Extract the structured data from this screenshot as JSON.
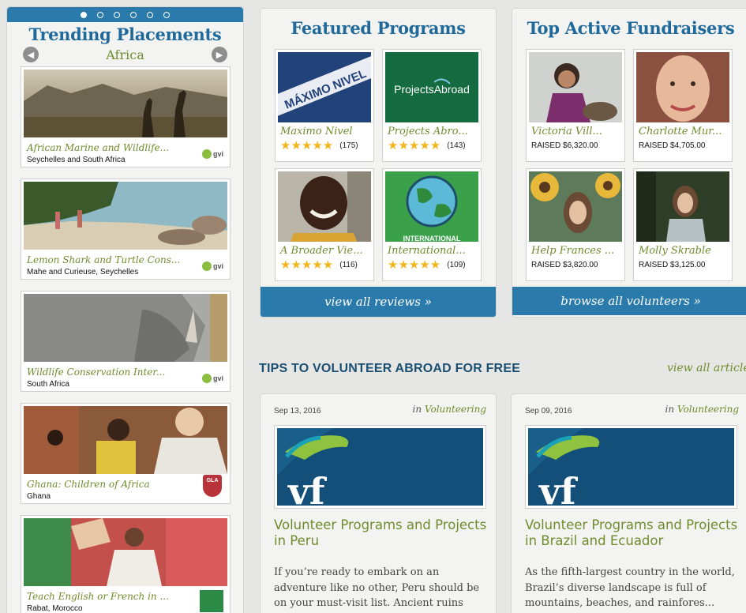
{
  "trending": {
    "title": "Trending Placements",
    "region": "Africa",
    "prev_icon": "chevron-left-icon",
    "next_icon": "chevron-right-icon",
    "placements": [
      {
        "title": "African Marine and Wildlife...",
        "location": "Seychelles and South Africa",
        "logo": "gvi"
      },
      {
        "title": "Lemon Shark and Turtle Cons...",
        "location": "Mahe and Curieuse, Seychelles",
        "logo": "gvi"
      },
      {
        "title": "Wildlife Conservation Inter...",
        "location": "South Africa",
        "logo": "gvi"
      },
      {
        "title": "Ghana: Children of Africa",
        "location": "Ghana",
        "logo": "GLA"
      },
      {
        "title": "Teach English or French in ...",
        "location": "Rabat, Morocco",
        "logo": ""
      }
    ]
  },
  "featured": {
    "title": "Featured Programs",
    "footer": "view all reviews »",
    "items": [
      {
        "name": "Maximo Nivel",
        "count": "(175)",
        "image_text": "MÁXIMO NIVEL"
      },
      {
        "name": "Projects Abro...",
        "count": "(143)",
        "image_text": "ProjectsAbroad"
      },
      {
        "name": "A Broader Vie...",
        "count": "(116)"
      },
      {
        "name": "International...",
        "count": "(109)",
        "image_text": "INTERNATIONAL"
      }
    ]
  },
  "fundraisers": {
    "title": "Top Active Fundraisers",
    "footer": "browse all volunteers »",
    "items": [
      {
        "name": "Victoria Vill...",
        "raised": "RAISED $6,320.00"
      },
      {
        "name": "Charlotte Mur...",
        "raised": "RAISED $4,705.00"
      },
      {
        "name": "Help Frances ...",
        "raised": "RAISED $3,820.00"
      },
      {
        "name": "Molly Skrable",
        "raised": "RAISED $3,125.00"
      }
    ]
  },
  "tips": {
    "header": "TIPS TO VOLUNTEER ABROAD FOR FREE",
    "view_all": "view all articles",
    "articles": [
      {
        "date": "Sep 13, 2016",
        "in_prefix": "in",
        "category": "Volunteering",
        "logo_text": "vf",
        "title": "Volunteer Programs and Projects in Peru",
        "excerpt": "If you’re ready to embark on an adventure like no other, Peru should be on your must-visit list. Ancient ruins suc..."
      },
      {
        "date": "Sep 09, 2016",
        "in_prefix": "in",
        "category": "Volunteering",
        "logo_text": "vf",
        "title": "Volunteer Programs and Projects in Brazil and Ecuador",
        "excerpt": "As the fifth-largest country in the world, Brazil’s diverse landscape is full of mountains, beaches, and rainfores..."
      }
    ]
  },
  "colors": {
    "accent_blue": "#2a7bab",
    "title_blue": "#1f6a9a",
    "green": "#6f8c2c",
    "star": "#f2b51b"
  }
}
